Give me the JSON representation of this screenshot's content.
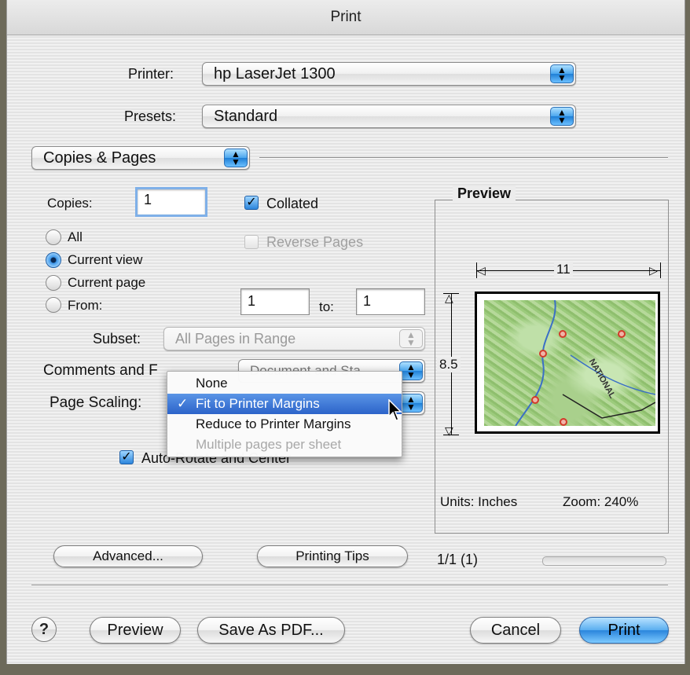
{
  "window": {
    "title": "Print"
  },
  "printer": {
    "label": "Printer:",
    "value": "hp LaserJet 1300"
  },
  "presets": {
    "label": "Presets:",
    "value": "Standard"
  },
  "panel": {
    "value": "Copies & Pages"
  },
  "copies": {
    "label": "Copies:",
    "value": "1"
  },
  "collated": {
    "label": "Collated",
    "checked": true
  },
  "reverse_pages": {
    "label": "Reverse Pages",
    "checked": false,
    "enabled": false
  },
  "range": {
    "options": [
      {
        "label": "All",
        "selected": false
      },
      {
        "label": "Current view",
        "selected": true
      },
      {
        "label": "Current page",
        "selected": false
      },
      {
        "label": "From:",
        "selected": false
      }
    ],
    "from_value": "1",
    "to_label": "to:",
    "to_value": "1"
  },
  "subset": {
    "label": "Subset:",
    "value": "All Pages in Range",
    "enabled": false
  },
  "comments": {
    "label": "Comments and F",
    "value": "Document and Sta"
  },
  "page_scaling": {
    "label": "Page Scaling:",
    "menu": [
      {
        "label": "None",
        "selected": false,
        "enabled": true
      },
      {
        "label": "Fit to Printer Margins",
        "selected": true,
        "enabled": true
      },
      {
        "label": "Reduce to Printer Margins",
        "selected": false,
        "enabled": true
      },
      {
        "label": "Multiple pages per sheet",
        "selected": false,
        "enabled": false
      }
    ],
    "checkmark": "✓"
  },
  "auto_rotate": {
    "label": "Auto-Rotate and Center",
    "checked": true
  },
  "preview": {
    "title": "Preview",
    "width_label": "11",
    "height_label": "8.5",
    "units": "Units: Inches",
    "zoom": "Zoom: 240%",
    "map_text": "NATIONAL"
  },
  "buttons": {
    "advanced": "Advanced...",
    "printing_tips": "Printing Tips",
    "help": "?",
    "preview": "Preview",
    "save_pdf": "Save As PDF...",
    "cancel": "Cancel",
    "print": "Print"
  },
  "page_count": "1/1 (1)",
  "colors": {
    "accent": "#2c63c9",
    "aqua": "#4aa6ee"
  }
}
